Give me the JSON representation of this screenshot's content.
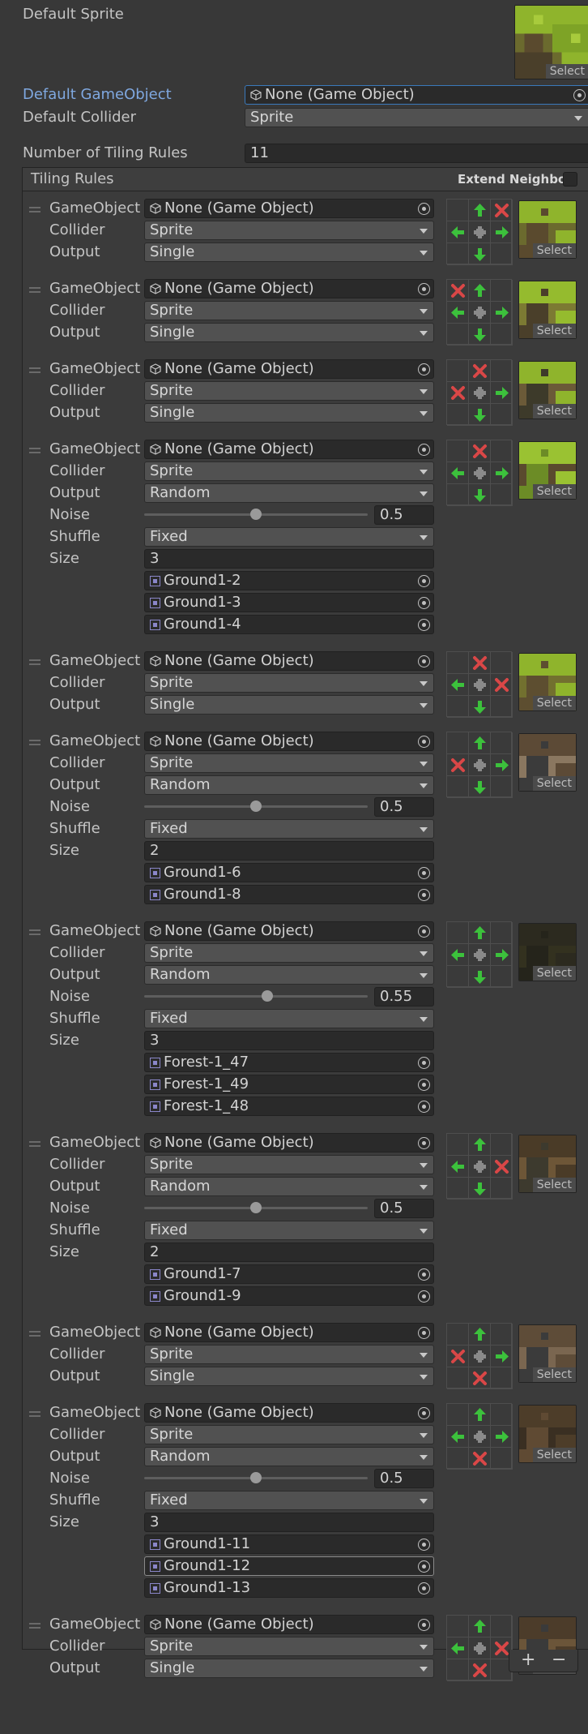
{
  "top": {
    "default_sprite_label": "Default Sprite",
    "default_gameobject_label": "Default GameObject",
    "default_gameobject_value": "None (Game Object)",
    "default_collider_label": "Default Collider",
    "default_collider_value": "Sprite",
    "num_rules_label": "Number of Tiling Rules",
    "num_rules_value": "11",
    "select_label": "Select"
  },
  "panel": {
    "title": "Tiling Rules",
    "extend_neighbor_label": "Extend Neighbor"
  },
  "labels": {
    "gameobject": "GameObject",
    "collider": "Collider",
    "output": "Output",
    "noise": "Noise",
    "shuffle": "Shuffle",
    "size": "Size",
    "select": "Select"
  },
  "footer": {
    "plus": "+",
    "minus": "−"
  },
  "colors": {
    "accent": "#3a79bb",
    "arrow_green": "#3cc13c",
    "cross_red": "#d94747"
  },
  "rules": [
    {
      "gameobject": "None (Game Object)",
      "collider": "Sprite",
      "output": "Single",
      "neighbors": [
        "",
        "up",
        "x",
        "left",
        "",
        "right",
        "",
        "down",
        ""
      ],
      "thumb": "grass-right"
    },
    {
      "gameobject": "None (Game Object)",
      "collider": "Sprite",
      "output": "Single",
      "neighbors": [
        "x",
        "up",
        "",
        "left",
        "",
        "right",
        "",
        "down",
        ""
      ],
      "thumb": "grass-left"
    },
    {
      "gameobject": "None (Game Object)",
      "collider": "Sprite",
      "output": "Single",
      "neighbors": [
        "",
        "x",
        "",
        "x",
        "",
        "right",
        "",
        "down",
        ""
      ],
      "thumb": "grass-corner"
    },
    {
      "gameobject": "None (Game Object)",
      "collider": "Sprite",
      "output": "Random",
      "noise": "0.5",
      "noise_frac": 0.5,
      "shuffle": "Fixed",
      "size": "3",
      "sprites": [
        "Ground1-2",
        "Ground1-3",
        "Ground1-4"
      ],
      "neighbors": [
        "",
        "x",
        "",
        "left",
        "",
        "right",
        "",
        "down",
        ""
      ],
      "thumb": "grass-top"
    },
    {
      "gameobject": "None (Game Object)",
      "collider": "Sprite",
      "output": "Single",
      "neighbors": [
        "",
        "x",
        "",
        "left",
        "",
        "x",
        "",
        "down",
        ""
      ],
      "thumb": "grass-corner-right"
    },
    {
      "gameobject": "None (Game Object)",
      "collider": "Sprite",
      "output": "Random",
      "noise": "0.5",
      "noise_frac": 0.5,
      "shuffle": "Fixed",
      "size": "2",
      "sprites": [
        "Ground1-6",
        "Ground1-8"
      ],
      "neighbors": [
        "",
        "up",
        "",
        "x",
        "",
        "right",
        "",
        "down",
        ""
      ],
      "thumb": "rock-left"
    },
    {
      "gameobject": "None (Game Object)",
      "collider": "Sprite",
      "output": "Random",
      "noise": "0.55",
      "noise_frac": 0.55,
      "shuffle": "Fixed",
      "size": "3",
      "sprites": [
        "Forest-1_47",
        "Forest-1_49",
        "Forest-1_48"
      ],
      "neighbors": [
        "",
        "up",
        "",
        "left",
        "",
        "right",
        "",
        "down",
        ""
      ],
      "thumb": "dark"
    },
    {
      "gameobject": "None (Game Object)",
      "collider": "Sprite",
      "output": "Random",
      "noise": "0.5",
      "noise_frac": 0.5,
      "shuffle": "Fixed",
      "size": "2",
      "sprites": [
        "Ground1-7",
        "Ground1-9"
      ],
      "neighbors": [
        "",
        "up",
        "",
        "left",
        "",
        "x",
        "",
        "down",
        ""
      ],
      "thumb": "rock-right"
    },
    {
      "gameobject": "None (Game Object)",
      "collider": "Sprite",
      "output": "Single",
      "neighbors": [
        "",
        "up",
        "",
        "x",
        "",
        "right",
        "",
        "x",
        ""
      ],
      "thumb": "rock-bottom-left"
    },
    {
      "gameobject": "None (Game Object)",
      "collider": "Sprite",
      "output": "Random",
      "noise": "0.5",
      "noise_frac": 0.5,
      "shuffle": "Fixed",
      "size": "3",
      "sprites": [
        "Ground1-11",
        "Ground1-12",
        "Ground1-13"
      ],
      "neighbors": [
        "",
        "up",
        "",
        "left",
        "",
        "right",
        "",
        "x",
        ""
      ],
      "thumb": "rock-bottom"
    },
    {
      "gameobject": "None (Game Object)",
      "collider": "Sprite",
      "output": "Single",
      "neighbors": [
        "",
        "up",
        "",
        "left",
        "",
        "x",
        "",
        "x",
        ""
      ],
      "thumb": "rock-bottom-right"
    }
  ]
}
